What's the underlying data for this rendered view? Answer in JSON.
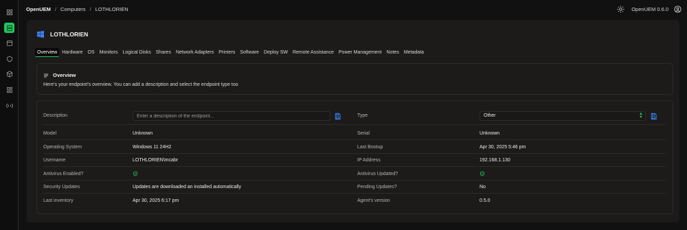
{
  "app": {
    "brand": "OpenUEM",
    "version": "OpenUEM 0.6.0"
  },
  "breadcrumb": {
    "items": [
      "OpenUEM",
      "Computers",
      "LOTHLORIEN"
    ],
    "separator": "/"
  },
  "sidebar": {
    "items": [
      {
        "icon": "dashboard-icon",
        "active": false
      },
      {
        "icon": "computers-icon",
        "active": true
      },
      {
        "icon": "window-icon",
        "active": false
      },
      {
        "icon": "shield-icon",
        "active": false
      },
      {
        "icon": "package-icon",
        "active": false
      },
      {
        "icon": "sites-icon",
        "active": false
      },
      {
        "icon": "remote-icon",
        "active": false
      }
    ],
    "accent": "#22c55e"
  },
  "header": {
    "title": "LOTHLORIEN",
    "os_icon": "windows-icon"
  },
  "tabs": [
    "Overview",
    "Hardware",
    "OS",
    "Monitors",
    "Logical Disks",
    "Shares",
    "Network Adapters",
    "Printers",
    "Software",
    "Deploy SW",
    "Remote Assistance",
    "Power Management",
    "Notes",
    "Metadata"
  ],
  "overview": {
    "title": "Overview",
    "description": "Here's your endpoint's overview. You can add a description and select the endpoint type too"
  },
  "details": {
    "description_label": "Description",
    "description_placeholder": "Enter a description of the endpoint...",
    "type_label": "Type",
    "type_value": "Other",
    "model_label": "Model",
    "model_value": "Unknown",
    "serial_label": "Serial",
    "serial_value": "Unknown",
    "os_label": "Operating System",
    "os_value": "Windows 11 24H2",
    "bootup_label": "Last Bootup",
    "bootup_value": "Apr 30, 2025 5:46 pm",
    "username_label": "Username",
    "username_value": "LOTHLORIEN\\mcabr",
    "ip_label": "IP Address",
    "ip_value": "192.168.1.130",
    "av_enabled_label": "Antivirus Enabled?",
    "av_updated_label": "Antivirus Updated?",
    "security_label": "Security Updates",
    "security_value": "Updates are downloaded an installed automatically",
    "pending_label": "Pending Updates?",
    "pending_value": "No",
    "inventory_label": "Last inventory",
    "inventory_value": "Apr 30, 2025 6:17 pm",
    "agent_label": "Agent's version",
    "agent_value": "0.5.0"
  },
  "colors": {
    "accent": "#22c55e",
    "save": "#3b82f6",
    "card": "#1d1b1a",
    "background": "#111111"
  }
}
